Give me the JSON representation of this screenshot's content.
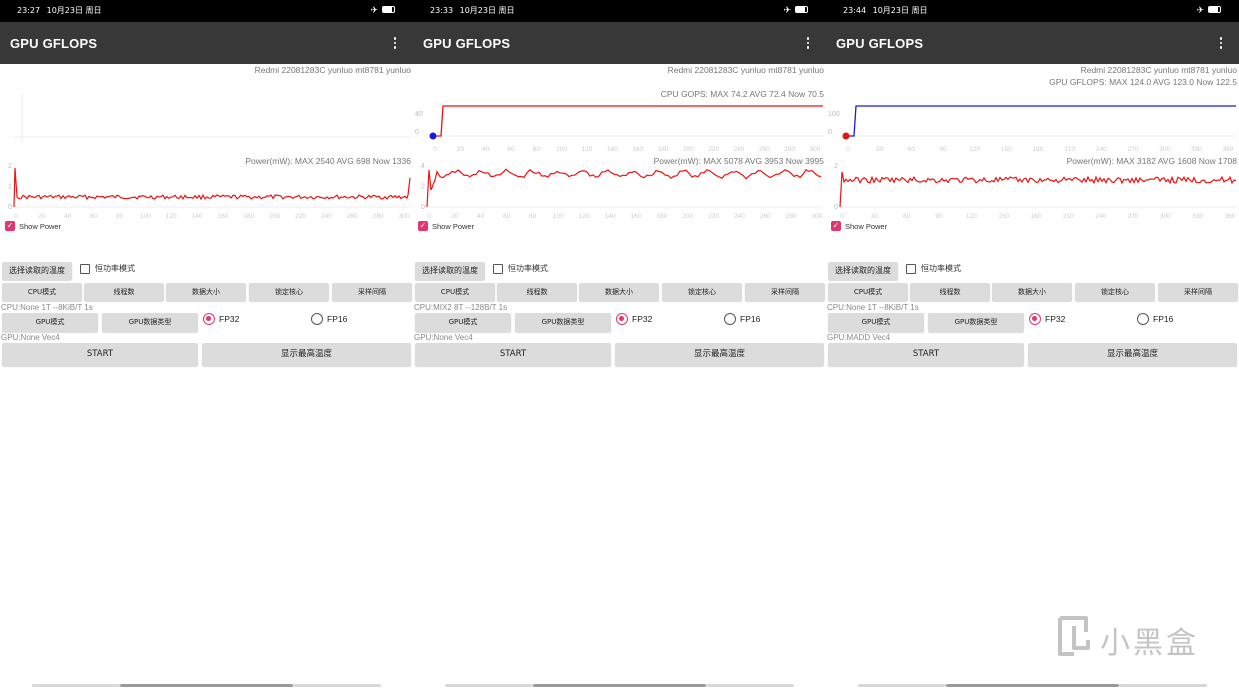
{
  "panels": [
    {
      "status": {
        "time": "23:27",
        "date": "10月23日 周日"
      },
      "app_title": "GPU GFLOPS",
      "device": "Redmi 22081283C yunluo mt8781 yunluo",
      "perf_text": "",
      "perf_kind": "none",
      "power_text": "Power(mW): MAX 2540 AVG 698 Now 1336",
      "show_power": "Show Power",
      "temp_button": "选择读取的温度",
      "constant_power": "恒功率模式",
      "cpu_mode": "CPU模式",
      "threads": "线程数",
      "data_size": "数据大小",
      "lock_core": "锁定核心",
      "sample_interval": "采样间隔",
      "cpu_line": "CPU:None 1T --8KiB/T 1s",
      "gpu_mode": "GPU模式",
      "gpu_data_type": "GPU数据类型",
      "fp32": "FP32",
      "fp16": "FP16",
      "gpu_line": "GPU:None Vec4",
      "start": "START",
      "show_max_temp": "显示最高温度",
      "top_chart": {
        "y_ticks": [],
        "x_ticks": []
      },
      "power_chart": {
        "y_ticks": [
          "2",
          "1",
          "0"
        ],
        "x_ticks": [
          "0",
          "20",
          "40",
          "60",
          "80",
          "100",
          "120",
          "140",
          "160",
          "180",
          "200",
          "220",
          "240",
          "260",
          "280",
          "300"
        ]
      }
    },
    {
      "status": {
        "time": "23:33",
        "date": "10月23日 周日"
      },
      "app_title": "GPU GFLOPS",
      "device": "Redmi 22081283C yunluo mt8781 yunluo",
      "perf_text": "CPU GOPS: MAX 74.2 AVG 72.4 Now 70.5",
      "perf_kind": "cpu",
      "power_text": "Power(mW): MAX 5078 AVG 3953 Now 3995",
      "show_power": "Show Power",
      "temp_button": "选择读取的温度",
      "constant_power": "恒功率模式",
      "cpu_mode": "CPU模式",
      "threads": "线程数",
      "data_size": "数据大小",
      "lock_core": "锁定核心",
      "sample_interval": "采样间隔",
      "cpu_line": "CPU:MIX2 8T --128B/T 1s",
      "gpu_mode": "GPU模式",
      "gpu_data_type": "GPU数据类型",
      "fp32": "FP32",
      "fp16": "FP16",
      "gpu_line": "GPU:None Vec4",
      "start": "START",
      "show_max_temp": "显示最高温度",
      "top_chart": {
        "y_ticks": [
          "40",
          "0"
        ],
        "x_ticks": [
          "0",
          "20",
          "40",
          "60",
          "80",
          "100",
          "120",
          "140",
          "160",
          "180",
          "200",
          "220",
          "240",
          "260",
          "280",
          "300"
        ]
      },
      "power_chart": {
        "y_ticks": [
          "4",
          "2",
          "0"
        ],
        "x_ticks": [
          "0",
          "20",
          "40",
          "60",
          "80",
          "100",
          "120",
          "140",
          "160",
          "180",
          "200",
          "220",
          "240",
          "260",
          "280",
          "300"
        ]
      }
    },
    {
      "status": {
        "time": "23:44",
        "date": "10月23日 周日"
      },
      "app_title": "GPU GFLOPS",
      "device": "Redmi 22081283C yunluo mt8781 yunluo",
      "perf_text": "GPU GFLOPS: MAX 124.0 AVG 123.0 Now 122.5",
      "perf_kind": "gpu",
      "power_text": "Power(mW): MAX 3182 AVG 1608 Now 1708",
      "show_power": "Show Power",
      "temp_button": "选择读取的温度",
      "constant_power": "恒功率模式",
      "cpu_mode": "CPU模式",
      "threads": "线程数",
      "data_size": "数据大小",
      "lock_core": "锁定核心",
      "sample_interval": "采样间隔",
      "cpu_line": "CPU:None 1T --8KiB/T 1s",
      "gpu_mode": "GPU模式",
      "gpu_data_type": "GPU数据类型",
      "fp32": "FP32",
      "fp16": "FP16",
      "gpu_line": "GPU:MADD Vec4",
      "start": "START",
      "show_max_temp": "显示最高温度",
      "top_chart": {
        "y_ticks": [
          "100",
          "0"
        ],
        "x_ticks": [
          "0",
          "30",
          "60",
          "90",
          "120",
          "150",
          "180",
          "210",
          "240",
          "270",
          "300",
          "330",
          "360"
        ]
      },
      "power_chart": {
        "y_ticks": [
          "2",
          "0"
        ],
        "x_ticks": [
          "0",
          "30",
          "60",
          "90",
          "120",
          "150",
          "180",
          "210",
          "240",
          "270",
          "300",
          "330",
          "360"
        ]
      }
    }
  ],
  "watermark": "小黑盒",
  "colors": {
    "perf_cpu": "#ee1111",
    "perf_gpu": "#1a1ad6",
    "power": "#ee1111",
    "accent": "#e5356e",
    "appbar": "#383838"
  },
  "icons": {
    "menu": "overflow-menu-icon",
    "airplane": "airplane-mode-icon",
    "battery": "battery-icon",
    "check": "checkbox-checked-icon",
    "logo": "xiaoheihe-logo-icon"
  }
}
